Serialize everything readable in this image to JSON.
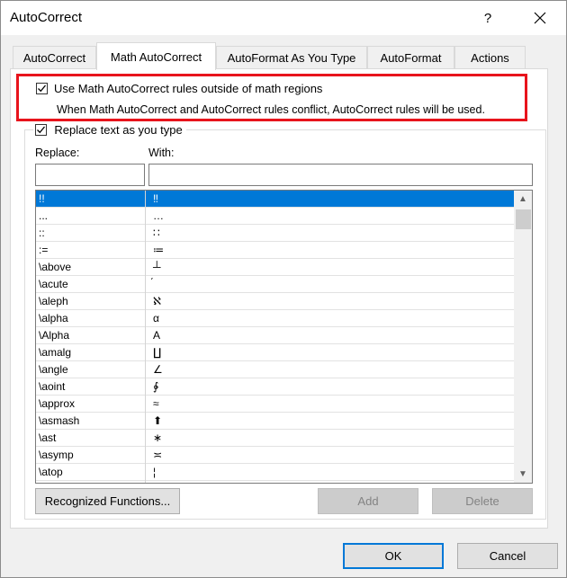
{
  "window": {
    "title": "AutoCorrect",
    "help_glyph": "?",
    "close_icon": "close-icon"
  },
  "tabs": [
    {
      "label": "AutoCorrect",
      "active": false
    },
    {
      "label": "Math AutoCorrect",
      "active": true
    },
    {
      "label": "AutoFormat As You Type",
      "active": false
    },
    {
      "label": "AutoFormat",
      "active": false
    },
    {
      "label": "Actions",
      "active": false
    }
  ],
  "options": {
    "use_outside_math_label": "Use Math AutoCorrect rules outside of math regions",
    "use_outside_math_checked": true,
    "conflict_note": "When Math AutoCorrect and AutoCorrect rules conflict, AutoCorrect rules will be used.",
    "replace_as_you_type_label": "Replace text as you type",
    "replace_as_you_type_checked": true
  },
  "form": {
    "replace_label": "Replace:",
    "with_label": "With:",
    "replace_value": "",
    "with_value": ""
  },
  "entries": [
    {
      "replace": "!!",
      "with": "‼",
      "selected": true
    },
    {
      "replace": "...",
      "with": "…"
    },
    {
      "replace": "::",
      "with": "∷"
    },
    {
      "replace": ":=",
      "with": "≔"
    },
    {
      "replace": "\\above",
      "with": "┴"
    },
    {
      "replace": "\\acute",
      "with": "́"
    },
    {
      "replace": "\\aleph",
      "with": "ℵ"
    },
    {
      "replace": "\\alpha",
      "with": "α"
    },
    {
      "replace": "\\Alpha",
      "with": "Α"
    },
    {
      "replace": "\\amalg",
      "with": "∐"
    },
    {
      "replace": "\\angle",
      "with": "∠"
    },
    {
      "replace": "\\aoint",
      "with": "∳"
    },
    {
      "replace": "\\approx",
      "with": "≈"
    },
    {
      "replace": "\\asmash",
      "with": "⬆"
    },
    {
      "replace": "\\ast",
      "with": "∗"
    },
    {
      "replace": "\\asymp",
      "with": "≍"
    },
    {
      "replace": "\\atop",
      "with": "¦"
    }
  ],
  "buttons": {
    "recognized_functions": "Recognized Functions...",
    "add": "Add",
    "delete": "Delete",
    "ok": "OK",
    "cancel": "Cancel"
  },
  "colors": {
    "selection": "#0078d7",
    "highlight_box": "#e8141c"
  }
}
